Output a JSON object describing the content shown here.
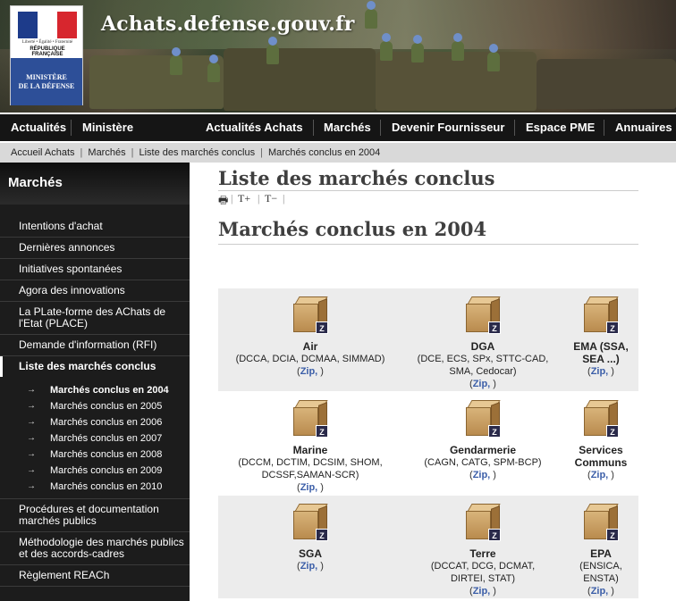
{
  "site": {
    "title": "Achats.defense.gouv.fr",
    "logo_motto": "Liberté • Égalité • Fraternité",
    "logo_republic": "RÉPUBLIQUE FRANÇAISE",
    "logo_ministry_line1": "MINISTÈRE",
    "logo_ministry_line2": "DE LA DÉFENSE"
  },
  "nav": [
    {
      "label": "Actualités"
    },
    {
      "label": "Ministère"
    },
    {
      "label": "Actualités Achats"
    },
    {
      "label": "Marchés"
    },
    {
      "label": "Devenir Fournisseur"
    },
    {
      "label": "Espace PME"
    },
    {
      "label": "Annuaires"
    }
  ],
  "breadcrumb": [
    {
      "label": "Accueil Achats"
    },
    {
      "label": "Marchés"
    },
    {
      "label": "Liste des marchés conclus"
    },
    {
      "label": "Marchés conclus en 2004"
    }
  ],
  "breadcrumb_sep": "|",
  "sidebar": {
    "title": "Marchés",
    "items": [
      {
        "label": "Intentions d'achat"
      },
      {
        "label": "Dernières annonces"
      },
      {
        "label": "Initiatives spontanées"
      },
      {
        "label": "Agora des innovations"
      },
      {
        "label": "La PLate-forme des AChats de l'Etat (PLACE)"
      },
      {
        "label": "Demande d'information (RFI)"
      },
      {
        "label": "Liste des marchés conclus"
      }
    ],
    "subitems": [
      {
        "label": "Marchés conclus en 2004"
      },
      {
        "label": "Marchés conclus en 2005"
      },
      {
        "label": "Marchés conclus en 2006"
      },
      {
        "label": "Marchés conclus en 2007"
      },
      {
        "label": "Marchés conclus en 2008"
      },
      {
        "label": "Marchés conclus en 2009"
      },
      {
        "label": "Marchés conclus en 2010"
      }
    ],
    "items_after": [
      {
        "label": "Procédures et documentation marchés publics"
      },
      {
        "label": "Méthodologie des marchés publics et des accords-cadres"
      },
      {
        "label": "Règlement REACh"
      }
    ],
    "arrow": "→"
  },
  "main": {
    "page_title": "Liste des marchés conclus",
    "tools": {
      "print": "🖶",
      "bigger": "T+",
      "smaller": "T−",
      "sep": "|"
    },
    "section_title": "Marchés conclus en 2004",
    "zip_label": "Zip,",
    "badge": "Z",
    "rows": [
      [
        {
          "name": "Air",
          "detail": "(DCCA, DCIA, DCMAA, SIMMAD)"
        },
        {
          "name": "DGA",
          "detail": "(DCE, ECS, SPx, STTC-CAD, SMA, Cedocar)"
        },
        {
          "name": "EMA (SSA, SEA ...)",
          "detail": ""
        }
      ],
      [
        {
          "name": "Marine",
          "detail": "(DCCM, DCTIM, DCSIM, SHOM, DCSSF,SAMAN-SCR)"
        },
        {
          "name": "Gendarmerie",
          "detail": "(CAGN, CATG, SPM-BCP)"
        },
        {
          "name": "Services Communs",
          "detail": ""
        }
      ],
      [
        {
          "name": "SGA",
          "detail": ""
        },
        {
          "name": "Terre",
          "detail": "(DCCAT, DCG, DCMAT, DIRTEI, STAT)"
        },
        {
          "name": "EPA",
          "detail": "(ENSICA, ENSTA)"
        }
      ]
    ]
  },
  "colors": {
    "nav_bg": "#151515",
    "sidebar_bg": "#1c1c1c",
    "breadcrumb_bg": "#d9d9d9",
    "grid_bg": "#ececec",
    "zip_link": "#3b5ea8",
    "flag_blue": "#1d3b8a",
    "flag_red": "#d7262e"
  }
}
